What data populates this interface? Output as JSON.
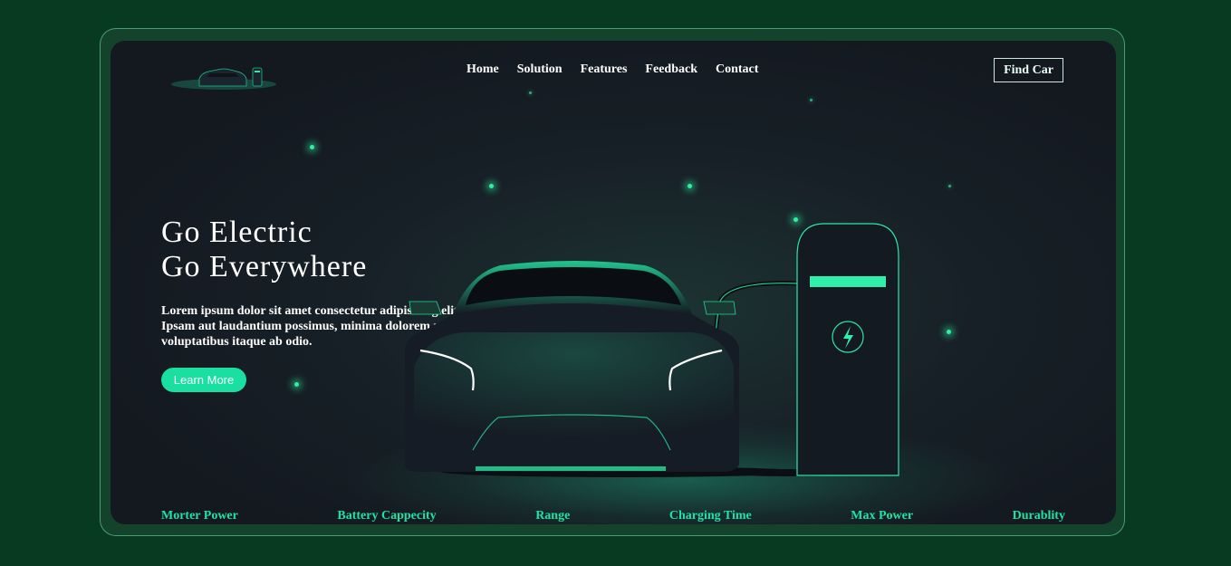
{
  "nav": {
    "links": [
      "Home",
      "Solution",
      "Features",
      "Feedback",
      "Contact"
    ],
    "cta": "Find Car"
  },
  "hero": {
    "title_line1": "Go Electric",
    "title_line2": "Go Everywhere",
    "description": "Lorem ipsum dolor sit amet consectetur adipisicing elit. Ipsam aut laudantium possimus, minima dolorem rem voluptatibus itaque ab odio.",
    "button": "Learn More"
  },
  "features": [
    "Morter Power",
    "Battery Cappecity",
    "Range",
    "Charging Time",
    "Max Power",
    "Durablity"
  ],
  "icons": {
    "logo": "car-charging-logo",
    "charger": "lightning-bolt-icon"
  },
  "colors": {
    "page_bg": "#083a22",
    "panel_bg": "#161b22",
    "accent": "#19e0a0"
  }
}
